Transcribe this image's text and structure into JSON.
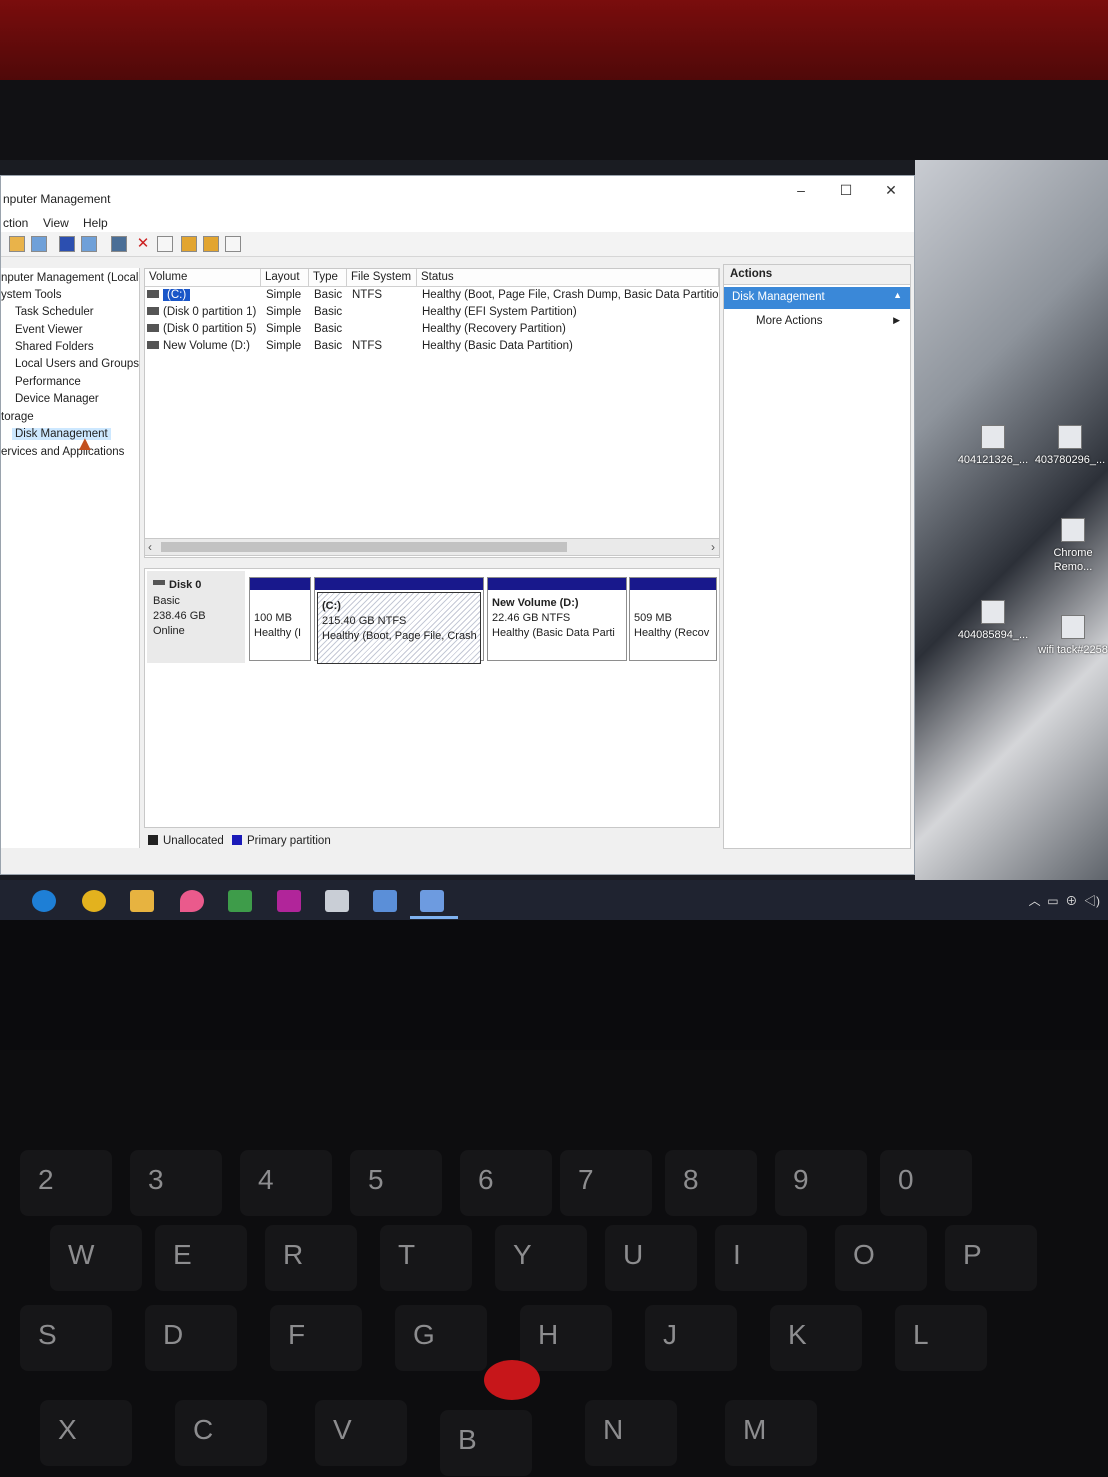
{
  "window": {
    "title": "nputer Management",
    "controls": {
      "minimize": "–",
      "maximize": "☐",
      "close": "✕"
    }
  },
  "menu": {
    "action": "ction",
    "view": "View",
    "help": "Help"
  },
  "tree": {
    "items": [
      "nputer Management (Local",
      "ystem Tools",
      "Task Scheduler",
      "Event Viewer",
      "Shared Folders",
      "Local Users and Groups",
      "Performance",
      "Device Manager",
      "torage",
      "Disk Management",
      "ervices and Applications"
    ],
    "selected": "Disk Management"
  },
  "volumes": {
    "headers": [
      "Volume",
      "Layout",
      "Type",
      "File System",
      "Status"
    ],
    "rows": [
      {
        "volume": "(C:)",
        "layout": "Simple",
        "type": "Basic",
        "fs": "NTFS",
        "status": "Healthy (Boot, Page File, Crash Dump, Basic Data Partitio"
      },
      {
        "volume": "(Disk 0 partition 1)",
        "layout": "Simple",
        "type": "Basic",
        "fs": "",
        "status": "Healthy (EFI System Partition)"
      },
      {
        "volume": "(Disk 0 partition 5)",
        "layout": "Simple",
        "type": "Basic",
        "fs": "",
        "status": "Healthy (Recovery Partition)"
      },
      {
        "volume": "New Volume (D:)",
        "layout": "Simple",
        "type": "Basic",
        "fs": "NTFS",
        "status": "Healthy (Basic Data Partition)"
      }
    ]
  },
  "disk": {
    "name": "Disk 0",
    "kind": "Basic",
    "size": "238.46 GB",
    "state": "Online",
    "partitions": [
      {
        "title": "",
        "size": "100 MB",
        "status": "Healthy (I"
      },
      {
        "title": "(C:)",
        "size": "215.40 GB NTFS",
        "status": "Healthy (Boot, Page File, Crash"
      },
      {
        "title": "New Volume  (D:)",
        "size": "22.46 GB NTFS",
        "status": "Healthy (Basic Data Parti"
      },
      {
        "title": "",
        "size": "509 MB",
        "status": "Healthy (Recov"
      }
    ]
  },
  "legend": {
    "unallocated": "Unallocated",
    "primary": "Primary partition",
    "unallocated_color": "#222222",
    "primary_color": "#1a1ab8"
  },
  "actions": {
    "header": "Actions",
    "selected": "Disk Management",
    "more": "More Actions"
  },
  "desktop": {
    "icons": [
      "404121326_...",
      "403780296_...",
      "Chrome Remo...",
      "404085894_...",
      "wifi tack#2258"
    ]
  },
  "keyboard": {
    "row1": [
      "2",
      "3",
      "4",
      "5",
      "6",
      "7",
      "8",
      "9",
      "0"
    ],
    "row2": [
      "W",
      "E",
      "R",
      "T",
      "Y",
      "U",
      "I",
      "O",
      "P"
    ],
    "row3": [
      "S",
      "D",
      "F",
      "G",
      "H",
      "J",
      "K",
      "L"
    ],
    "row4": [
      "X",
      "C",
      "V",
      "B",
      "N",
      "M"
    ]
  }
}
